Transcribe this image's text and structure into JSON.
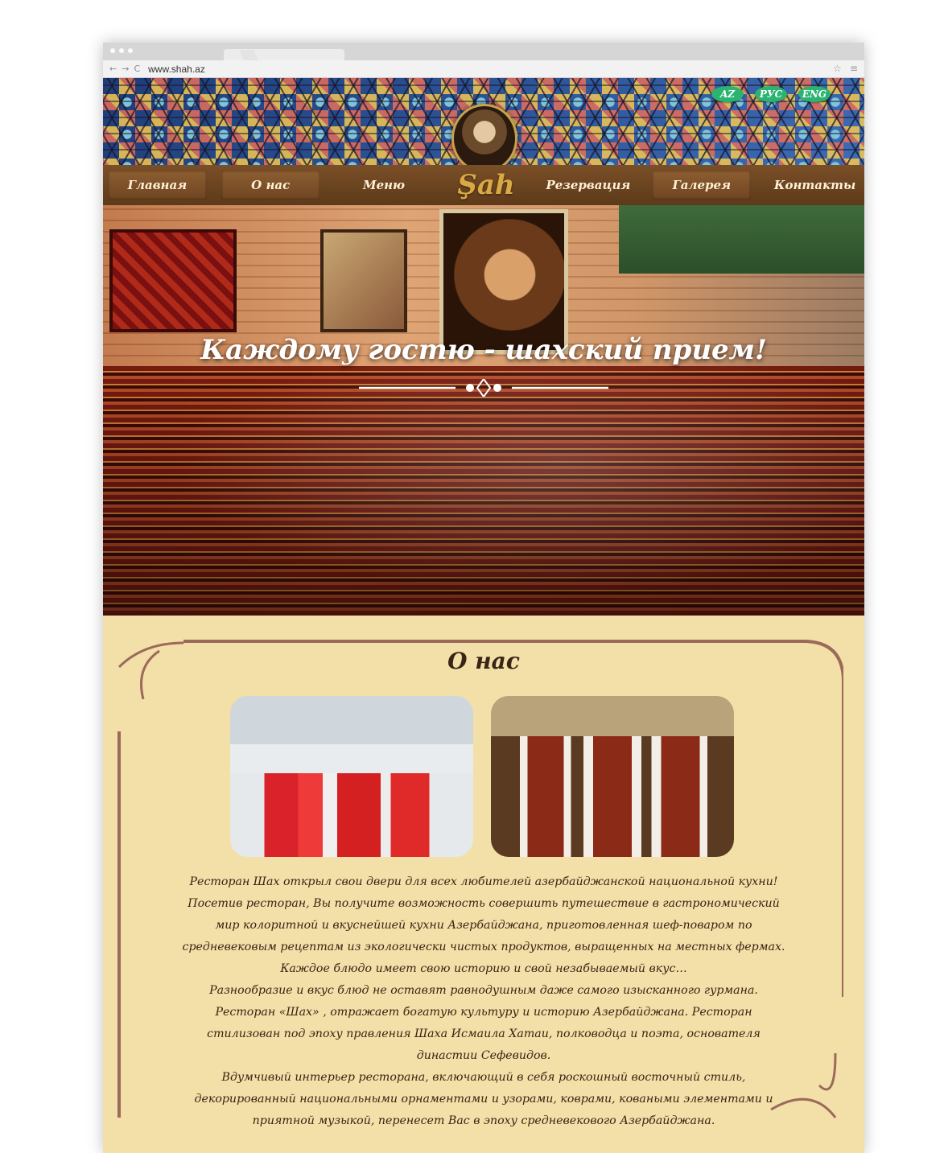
{
  "browser": {
    "url": "www.shah.az",
    "nav": [
      "←",
      "→",
      "C"
    ],
    "right_icons": [
      "☆",
      "≡"
    ]
  },
  "header": {
    "languages": [
      "AZ",
      "РУС",
      "ENG"
    ],
    "logo_text": "Şah"
  },
  "nav": {
    "items": [
      "Главная",
      "О нас",
      "Меню",
      "Резервация",
      "Галерея",
      "Контакты"
    ]
  },
  "hero": {
    "title": "Каждому гостю - шахский прием!"
  },
  "about": {
    "title": "О нас",
    "lines": [
      "Ресторан Шах открыл свои двери для всех любителей азербайджанской национальной кухни!",
      "Посетив ресторан, Вы получите возможность совершить путешествие в гастрономический",
      "мир колоритной и вкуснейшей кухни Азербайджана, приготовленная шеф-поваром по",
      "средневековым рецептам из экологически чистых продуктов, выращенных на местных фермах.",
      "Каждое блюдо имеет свою историю и свой незабываемый вкус…",
      "Разнообразие и вкус блюд не оставят равнодушным даже самого изысканного гурмана.",
      "Ресторан «Шах» , отражает богатую культуру и историю Азербайджана. Ресторан",
      "стилизован под эпоху правления Шаха Исмаила Хатаи, полководца и поэта, основателя",
      "династии Сефевидов.",
      "Вдумчивый интерьер ресторана, включающий в себя роскошный восточный стиль,",
      "декорированный национальными орнаментами и узорами, коврами, коваными элементами и",
      "приятной музыкой, перенесет Вас в эпоху средневекового Азербайджана."
    ]
  },
  "colors": {
    "nav_bg": "#6f4522",
    "lang_green": "#2bb371",
    "about_bg": "#f3dfa8",
    "frame": "#9b6a5a"
  }
}
